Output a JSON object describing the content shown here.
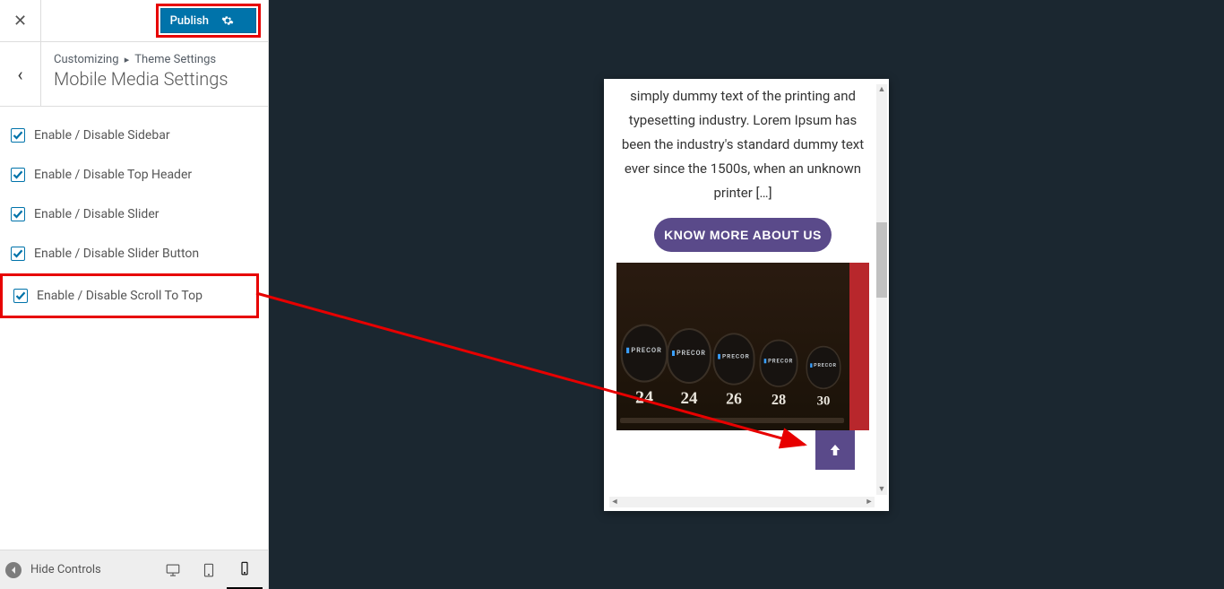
{
  "topbar": {
    "publish_label": "Publish"
  },
  "breadcrumb": {
    "root": "Customizing",
    "parent": "Theme Settings",
    "title": "Mobile Media Settings"
  },
  "options": [
    {
      "label": "Enable / Disable Sidebar",
      "checked": true,
      "highlight": false
    },
    {
      "label": "Enable / Disable Top Header",
      "checked": true,
      "highlight": false
    },
    {
      "label": "Enable / Disable Slider",
      "checked": true,
      "highlight": false
    },
    {
      "label": "Enable / Disable Slider Button",
      "checked": true,
      "highlight": false
    },
    {
      "label": "Enable / Disable Scroll To Top",
      "checked": true,
      "highlight": true
    }
  ],
  "footer": {
    "hide_controls": "Hide Controls"
  },
  "preview": {
    "about_text": "simply dummy text of the printing and typesetting industry. Lorem Ipsum has been the industry's standard dummy text ever since the 1500s, when an unknown printer […]",
    "know_more": "KNOW MORE ABOUT US",
    "dumbbells": {
      "brand": "PRECOR",
      "numbers": [
        "24",
        "24",
        "26",
        "28",
        "30"
      ]
    }
  }
}
